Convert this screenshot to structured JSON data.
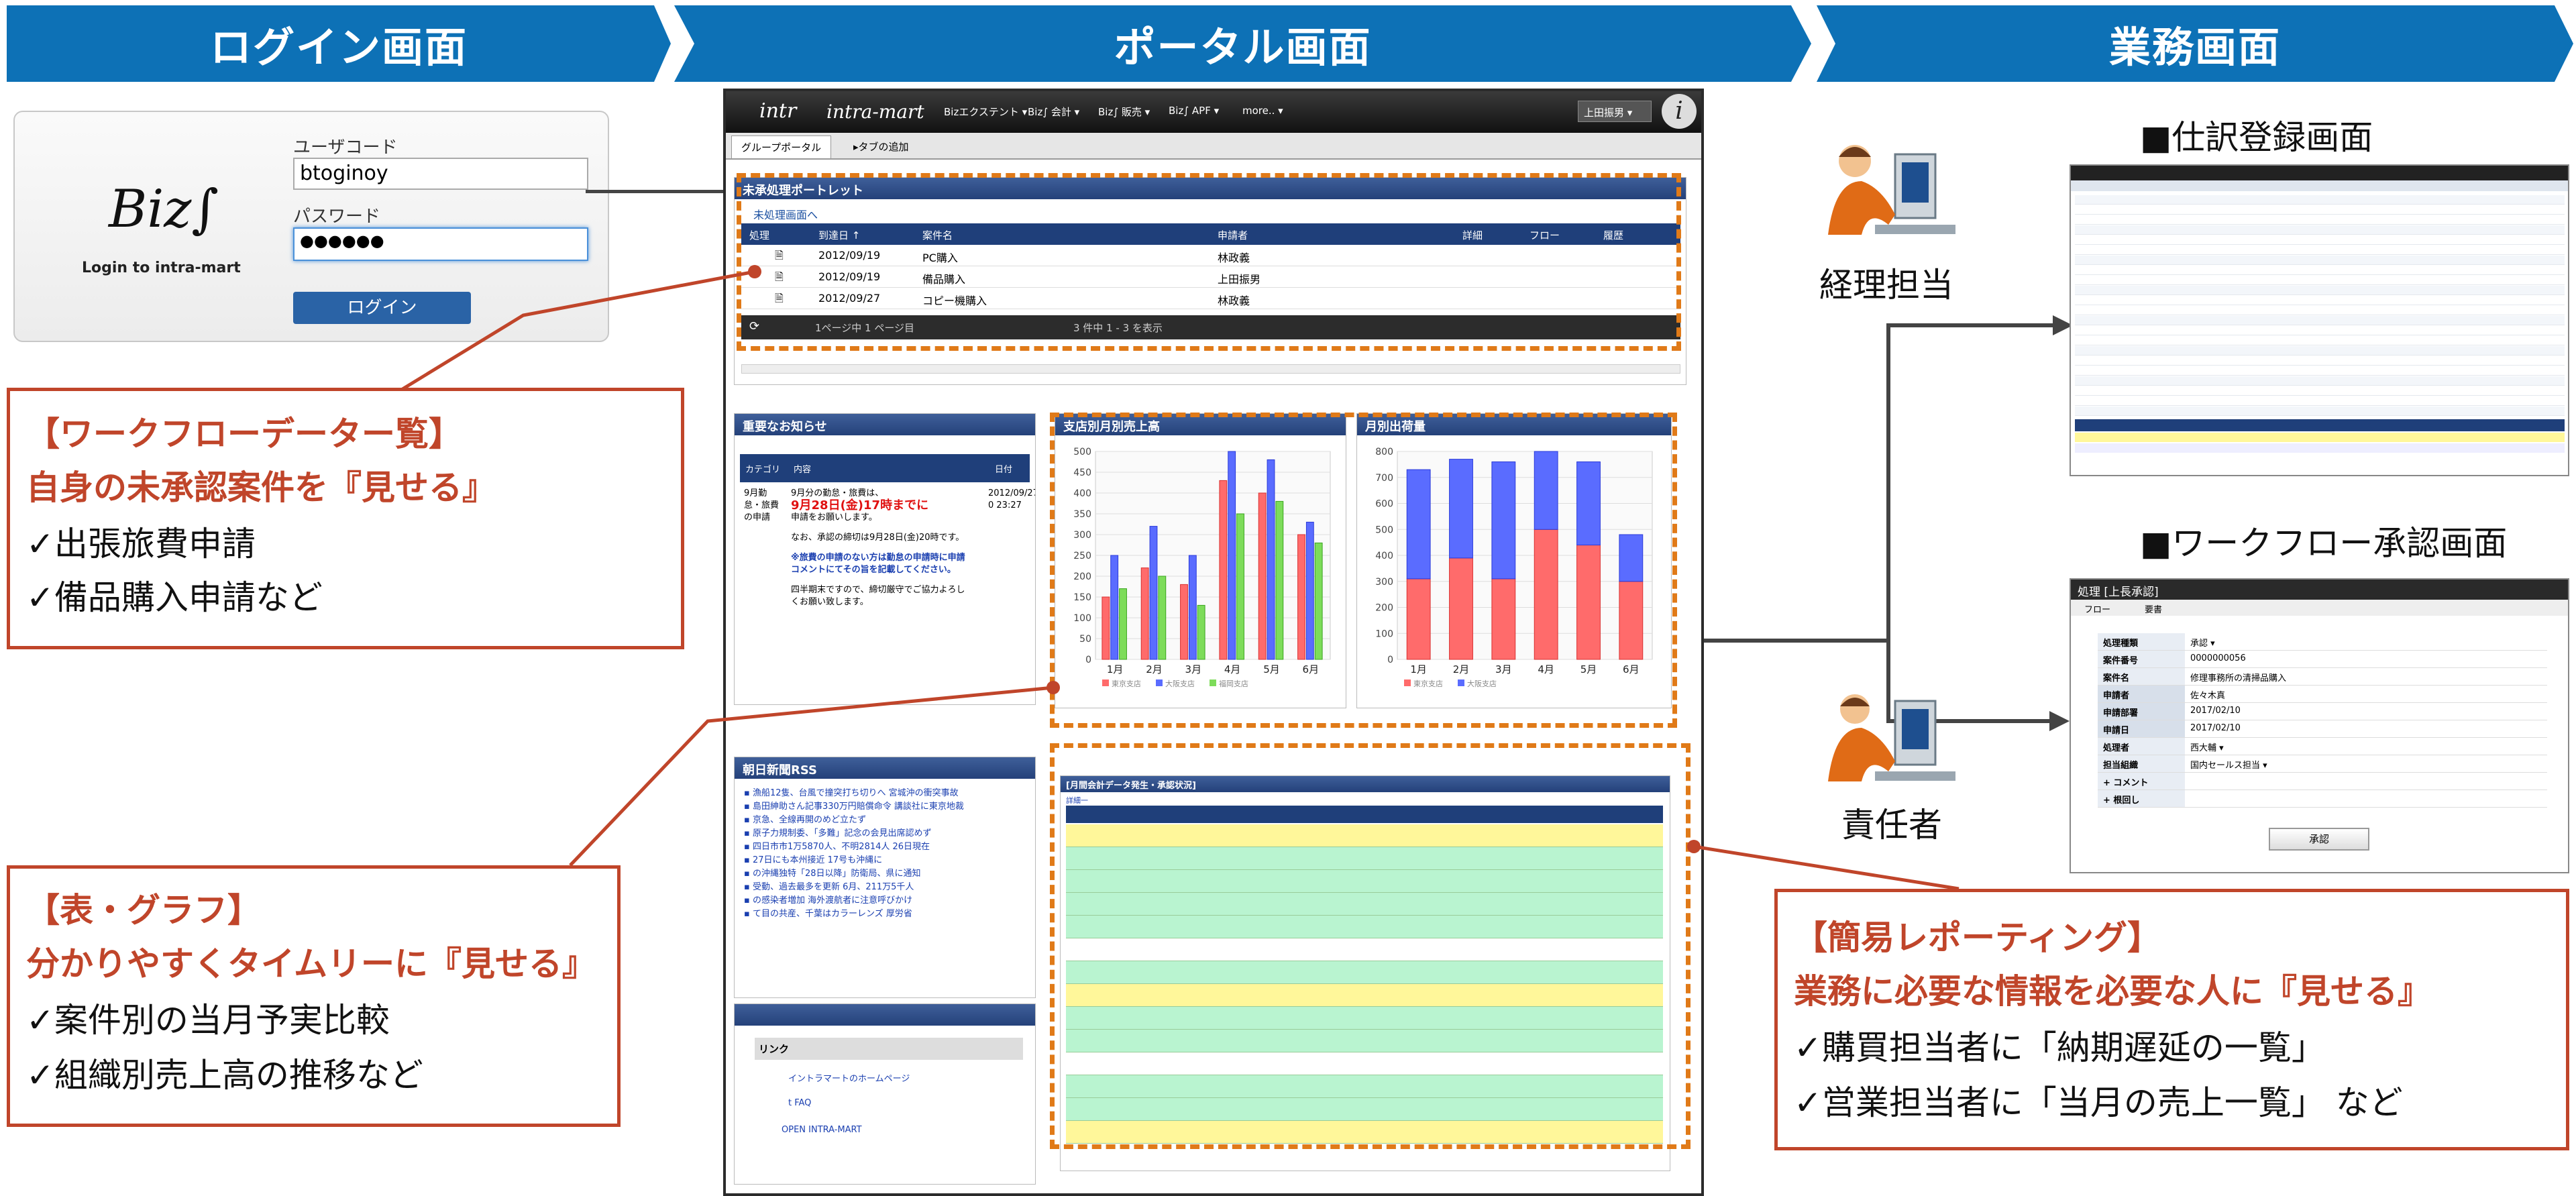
{
  "banners": {
    "login": "ログイン画面",
    "portal": "ポータル画面",
    "business": "業務画面"
  },
  "login": {
    "user_label": "ユーザコード",
    "user_value": "btoginoy",
    "pass_label": "パスワード",
    "pass_value": "●●●●●●",
    "button": "ログイン",
    "logo_text": "Biz∫",
    "caption": "Login to intra-mart"
  },
  "portal": {
    "brand1": "intr",
    "brand2": "intra-mart",
    "menu": [
      "Bizエクステント ▾",
      "Biz∫ 会計 ▾",
      "Biz∫ 販売 ▾",
      "Biz∫ APF ▾",
      "more.. ▾"
    ],
    "user": "上田振男 ▾",
    "tabs": [
      "グループポータル",
      "▸タブの追加"
    ],
    "workflow": {
      "title": "未承処理ポートレット",
      "link": "未処理画面へ",
      "headers": [
        "処理",
        "到達日 ↑",
        "案件名",
        "申請者",
        "詳細",
        "フロー",
        "履歴"
      ],
      "rows": [
        [
          "2012/09/19",
          "PC購入",
          "林政義"
        ],
        [
          "2012/09/19",
          "備品購入",
          "上田振男"
        ],
        [
          "2012/09/27",
          "コピー機購入",
          "林政義"
        ]
      ],
      "pager": "1ページ中 1 ページ目",
      "count": "3 件中 1 - 3 を表示"
    },
    "notice": {
      "title": "重要なお知らせ",
      "headers": [
        "カテゴリ",
        "内容",
        "日付"
      ],
      "category": "9月勤怠・旅費の申請",
      "line1": "9月分の勤怠・旅費は、",
      "line2": "9月28日(金)17時までに",
      "line3": "申請をお願いします。",
      "line4": "なお、承認の締切は9月28日(金)20時です。",
      "line5": "※旅費の申請のない方は勤怠の申請時に申請コメントにてその旨を記載してください。",
      "line6": "四半期末ですので、締切厳守でご協力よろしくお願い致します。",
      "date": "2012/09/27 0 23:27"
    },
    "rss": {
      "title": "朝日新聞RSS",
      "items": [
        "漁船12隻、台風で撞突打ち切りへ 宮城沖の衝突事故",
        "島田紳助さん記事330万円賠償命令 講談社に東京地裁",
        "京急、全線再開のめど立たず",
        "原子力規制委、「多難」記念の会見出席認めず",
        "四日市市1万5870人、不明2814人 26日現在",
        "27日にも本州接近 17号も沖縄に",
        "の沖縄独特「28日以降」防衛局、県に通知",
        "受動、過去最多を更新 6月、211万5千人",
        "の感染者増加 海外渡航者に注意呼びかけ",
        "て目の共産、千葉はカラーレンズ 厚労省"
      ],
      "links_title": "リンク",
      "links": [
        "イントラマートのホームページ",
        "t FAQ",
        "OPEN INTRA-MART"
      ]
    },
    "chart1": {
      "title": "支店別月別売上高"
    },
    "chart2": {
      "title": "月別出荷量"
    },
    "report": {
      "title": "[月間会計データ発生・承認状況]",
      "sub": "詳細一"
    }
  },
  "chart_data": [
    {
      "type": "bar",
      "title": "支店別月別売上高",
      "categories": [
        "1月",
        "2月",
        "3月",
        "4月",
        "5月",
        "6月"
      ],
      "series": [
        {
          "name": "東京支店",
          "values": [
            150,
            220,
            180,
            430,
            400,
            300
          ]
        },
        {
          "name": "大阪支店",
          "values": [
            250,
            320,
            250,
            500,
            480,
            330
          ]
        },
        {
          "name": "福岡支店",
          "values": [
            170,
            200,
            130,
            350,
            380,
            280
          ]
        }
      ],
      "ylim": [
        0,
        500
      ],
      "yticks": [
        0,
        50,
        100,
        150,
        200,
        250,
        300,
        350,
        400,
        450,
        500
      ]
    },
    {
      "type": "bar",
      "title": "月別出荷量",
      "categories": [
        "1月",
        "2月",
        "3月",
        "4月",
        "5月",
        "6月"
      ],
      "series": [
        {
          "name": "東京支店",
          "values": [
            310,
            390,
            310,
            500,
            440,
            300
          ]
        },
        {
          "name": "大阪支店",
          "values": [
            420,
            380,
            450,
            300,
            320,
            180
          ]
        }
      ],
      "stacked": true,
      "ylim": [
        0,
        800
      ],
      "yticks": [
        0,
        100,
        200,
        300,
        400,
        500,
        600,
        700,
        800
      ]
    }
  ],
  "callouts": {
    "wf": {
      "title1": "【ワークフローデーター覧】",
      "title2": "自身の未承認案件を『見せる』",
      "b1": "✓出張旅費申請",
      "b2": "✓備品購入申請など"
    },
    "chart": {
      "title1": "【表・グラフ】",
      "title2": "分かりやすくタイムリーに『見せる』",
      "b1": "✓案件別の当月予実比較",
      "b2": "✓組織別売上高の推移など"
    },
    "report": {
      "title1": "【簡易レポーティング】",
      "title2": "業務に必要な情報を必要な人に『見せる』",
      "b1": "✓購買担当者に「納期遅延の一覧」",
      "b2": "✓営業担当者に「当月の売上一覧」 など"
    }
  },
  "business": {
    "accountant": "経理担当",
    "manager": "責任者",
    "screen1": "■仕訳登録画面",
    "screen2": "■ワークフロー承認画面",
    "approve": {
      "header": "処理 [上長承認]",
      "tabs": [
        "フロー",
        "要書"
      ],
      "fields": [
        [
          "処理種類",
          "承認 ▾"
        ],
        [
          "案件番号",
          "0000000056"
        ],
        [
          "案件名",
          "修理事務所の清掃品購入"
        ]
      ],
      "applicant_rows": [
        [
          "申請者",
          "佐々木真"
        ],
        [
          "申請部署",
          "2017/02/10"
        ],
        [
          "申請日",
          "2017/02/10"
        ]
      ],
      "fields2": [
        [
          "処理者",
          "西大輔 ▾"
        ],
        [
          "担当組織",
          "国内セールス担当 ▾"
        ]
      ],
      "extra": [
        "コメント",
        "根回し"
      ],
      "button": "承認"
    }
  }
}
